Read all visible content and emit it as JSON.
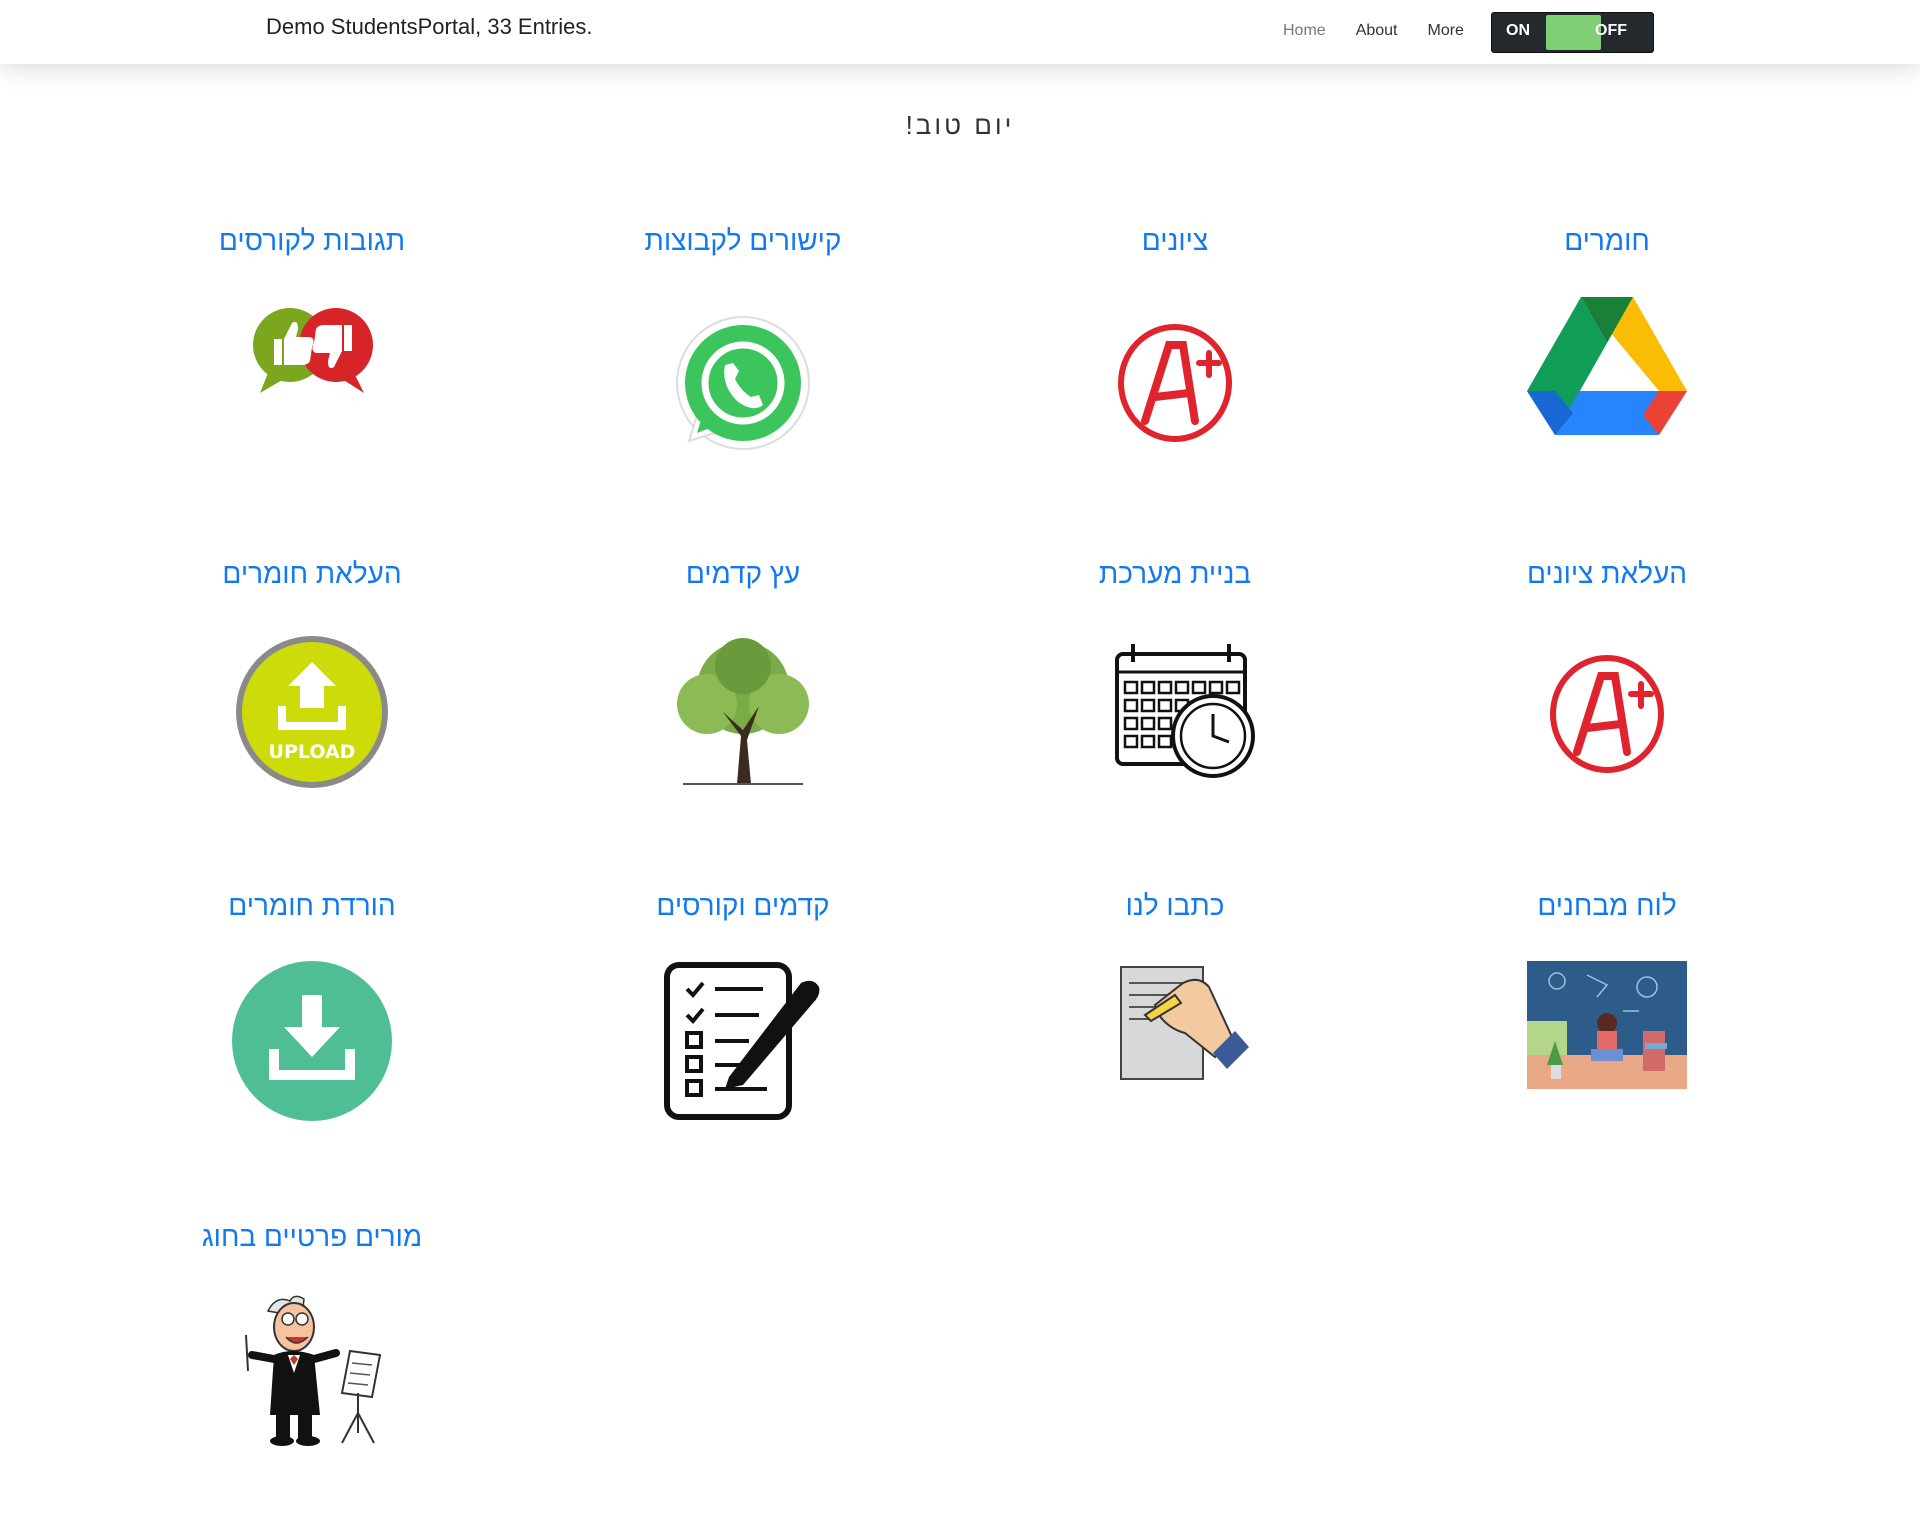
{
  "navbar": {
    "brand": "Demo StudentsPortal, 33 Entries.",
    "links": [
      "Home",
      "About",
      "More"
    ],
    "toggle": {
      "on_label": "ON",
      "off_label": "OFF"
    }
  },
  "greeting": "יום טוב!",
  "tiles": [
    {
      "title": "תגובות לקורסים",
      "icon": "feedback-thumbs-icon"
    },
    {
      "title": "קישורים לקבוצות",
      "icon": "whatsapp-icon"
    },
    {
      "title": "ציונים",
      "icon": "grade-a-plus-icon"
    },
    {
      "title": "חומרים",
      "icon": "google-drive-icon"
    },
    {
      "title": "העלאת חומרים",
      "icon": "upload-icon"
    },
    {
      "title": "עץ קדמים",
      "icon": "tree-icon"
    },
    {
      "title": "בניית מערכת",
      "icon": "calendar-clock-icon"
    },
    {
      "title": "העלאת ציונים",
      "icon": "grade-a-plus-icon"
    },
    {
      "title": "הורדת חומרים",
      "icon": "download-icon"
    },
    {
      "title": "קדמים וקורסים",
      "icon": "checklist-pen-icon"
    },
    {
      "title": "כתבו לנו",
      "icon": "writing-hand-icon"
    },
    {
      "title": "לוח מבחנים",
      "icon": "study-illustration-icon"
    },
    {
      "title": "מורים פרטיים בחוג",
      "icon": "teacher-cartoon-icon"
    }
  ],
  "colors": {
    "link": "#1279ee",
    "toggle_bg": "#24292e",
    "toggle_knob": "#7fcf76"
  }
}
